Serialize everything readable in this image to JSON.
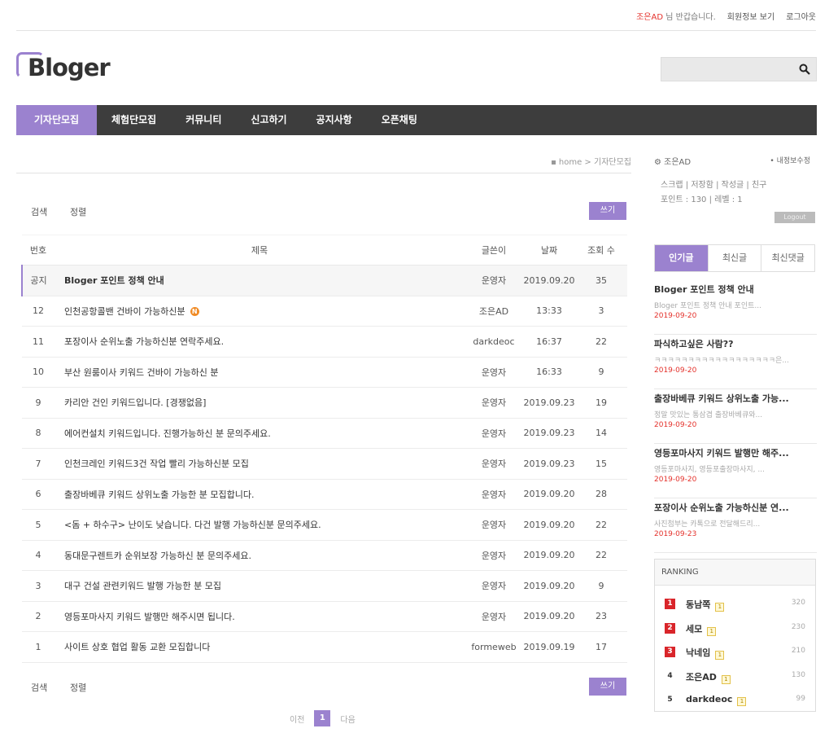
{
  "header": {
    "greeting_nick": "조은AD",
    "greeting_suffix": "님 반갑습니다.",
    "member_info_link": "회원정보 보기",
    "logout_link": "로그아웃",
    "logo": "Bloger",
    "search_placeholder": ""
  },
  "nav": {
    "items": [
      {
        "label": "기자단모집",
        "active": true
      },
      {
        "label": "체험단모집"
      },
      {
        "label": "커뮤니티"
      },
      {
        "label": "신고하기"
      },
      {
        "label": "공지사항"
      },
      {
        "label": "오픈채팅"
      }
    ]
  },
  "breadcrumb": {
    "home": "home",
    "sep": ">",
    "current": "기자단모집"
  },
  "board": {
    "search_label": "검색",
    "sort_label": "정렬",
    "write_label": "쓰기",
    "columns": [
      "번호",
      "제목",
      "글쓴이",
      "날짜",
      "조회 수"
    ],
    "rows": [
      {
        "no": "공지",
        "title": "Bloger 포인트 정책 안내",
        "author": "운영자",
        "date": "2019.09.20",
        "views": "35",
        "notice": true
      },
      {
        "no": "12",
        "title": "인천공항콜밴 건바이 가능하신분",
        "author": "조은AD",
        "date": "13:33",
        "views": "3",
        "badge": "N"
      },
      {
        "no": "11",
        "title": "포장이사 순위노출 가능하신분 연락주세요.",
        "author": "darkdeoc",
        "date": "16:37",
        "views": "22"
      },
      {
        "no": "10",
        "title": "부산 원룸이사 키워드 건바이 가능하신 분",
        "author": "운영자",
        "date": "16:33",
        "views": "9"
      },
      {
        "no": "9",
        "title": "카리안 건인 키워드입니다. [경쟁없음]",
        "author": "운영자",
        "date": "2019.09.23",
        "views": "19"
      },
      {
        "no": "8",
        "title": "에어컨설치 키워드입니다. 진행가능하신 분 문의주세요.",
        "author": "운영자",
        "date": "2019.09.23",
        "views": "14"
      },
      {
        "no": "7",
        "title": "인천크레인 키워드3건 작업 빨리 가능하신분 모집",
        "author": "운영자",
        "date": "2019.09.23",
        "views": "15"
      },
      {
        "no": "6",
        "title": "출장바베큐 키워드 상위노출 가능한 분 모집합니다.",
        "author": "운영자",
        "date": "2019.09.20",
        "views": "28"
      },
      {
        "no": "5",
        "title": "<돔 + 하수구> 난이도 낮습니다. 다건 발행 가능하신분 문의주세요.",
        "author": "운영자",
        "date": "2019.09.20",
        "views": "22"
      },
      {
        "no": "4",
        "title": "동대문구렌트카 순위보장 가능하신 분 문의주세요.",
        "author": "운영자",
        "date": "2019.09.20",
        "views": "22"
      },
      {
        "no": "3",
        "title": "대구 건설 관련키워드 발행 가능한 분 모집",
        "author": "운영자",
        "date": "2019.09.20",
        "views": "9"
      },
      {
        "no": "2",
        "title": "영등포마사지 키워드 발행만 해주시면 됩니다.",
        "author": "운영자",
        "date": "2019.09.20",
        "views": "23"
      },
      {
        "no": "1",
        "title": "사이트 상호 협업 활동 교환 모집합니다",
        "author": "formeweb",
        "date": "2019.09.19",
        "views": "17"
      }
    ],
    "pager": {
      "prev": "이전",
      "current": "1",
      "next": "다음"
    }
  },
  "sidebar": {
    "user": {
      "name": "조은AD",
      "edit_link": "• 내정보수정",
      "links": "스크랩 | 저장함 | 작성글 | 친구",
      "points": "포인트 : 130 | 레벨 : 1",
      "logout_button": "Logout"
    },
    "tabs": [
      {
        "label": "인기글",
        "active": true
      },
      {
        "label": "최신글"
      },
      {
        "label": "최신댓글"
      }
    ],
    "posts": [
      {
        "title": "Bloger 포인트 정책 안내",
        "excerpt": "Bloger 포인트 정책 안내 포인트...",
        "date": "2019-09-20"
      },
      {
        "title": "파식하고싶은 사람??",
        "excerpt": "ㅋㅋㅋㅋㅋㅋㅋㅋㅋㅋㅋㅋㅋㅋㅋㅋㅋㅋ은...",
        "date": "2019-09-20"
      },
      {
        "title": "출장바베큐 키워드 상위노출 가능...",
        "excerpt": "정말 맛있는 통삼겹 출장바베큐와...",
        "date": "2019-09-20"
      },
      {
        "title": "영등포마사지 키워드 발행만 해주...",
        "excerpt": "영등포마사지, 영등포출장마사지, ...",
        "date": "2019-09-20"
      },
      {
        "title": "포장이사 순위노출 가능하신분 연...",
        "excerpt": "사진첨부는 카톡으로 전달해드리...",
        "date": "2019-09-23"
      }
    ],
    "ranking": {
      "title": "RANKING",
      "items": [
        {
          "rank": "1",
          "name": "동남쪽",
          "points": "320"
        },
        {
          "rank": "2",
          "name": "세모",
          "points": "230"
        },
        {
          "rank": "3",
          "name": "낙네임",
          "points": "210"
        },
        {
          "rank": "4",
          "name": "조은AD",
          "points": "130"
        },
        {
          "rank": "5",
          "name": "darkdeoc",
          "points": "99"
        }
      ]
    }
  },
  "colors": {
    "accent": "#9b82cf",
    "nav_bg": "#3d3d3d",
    "red": "#e4312b"
  }
}
